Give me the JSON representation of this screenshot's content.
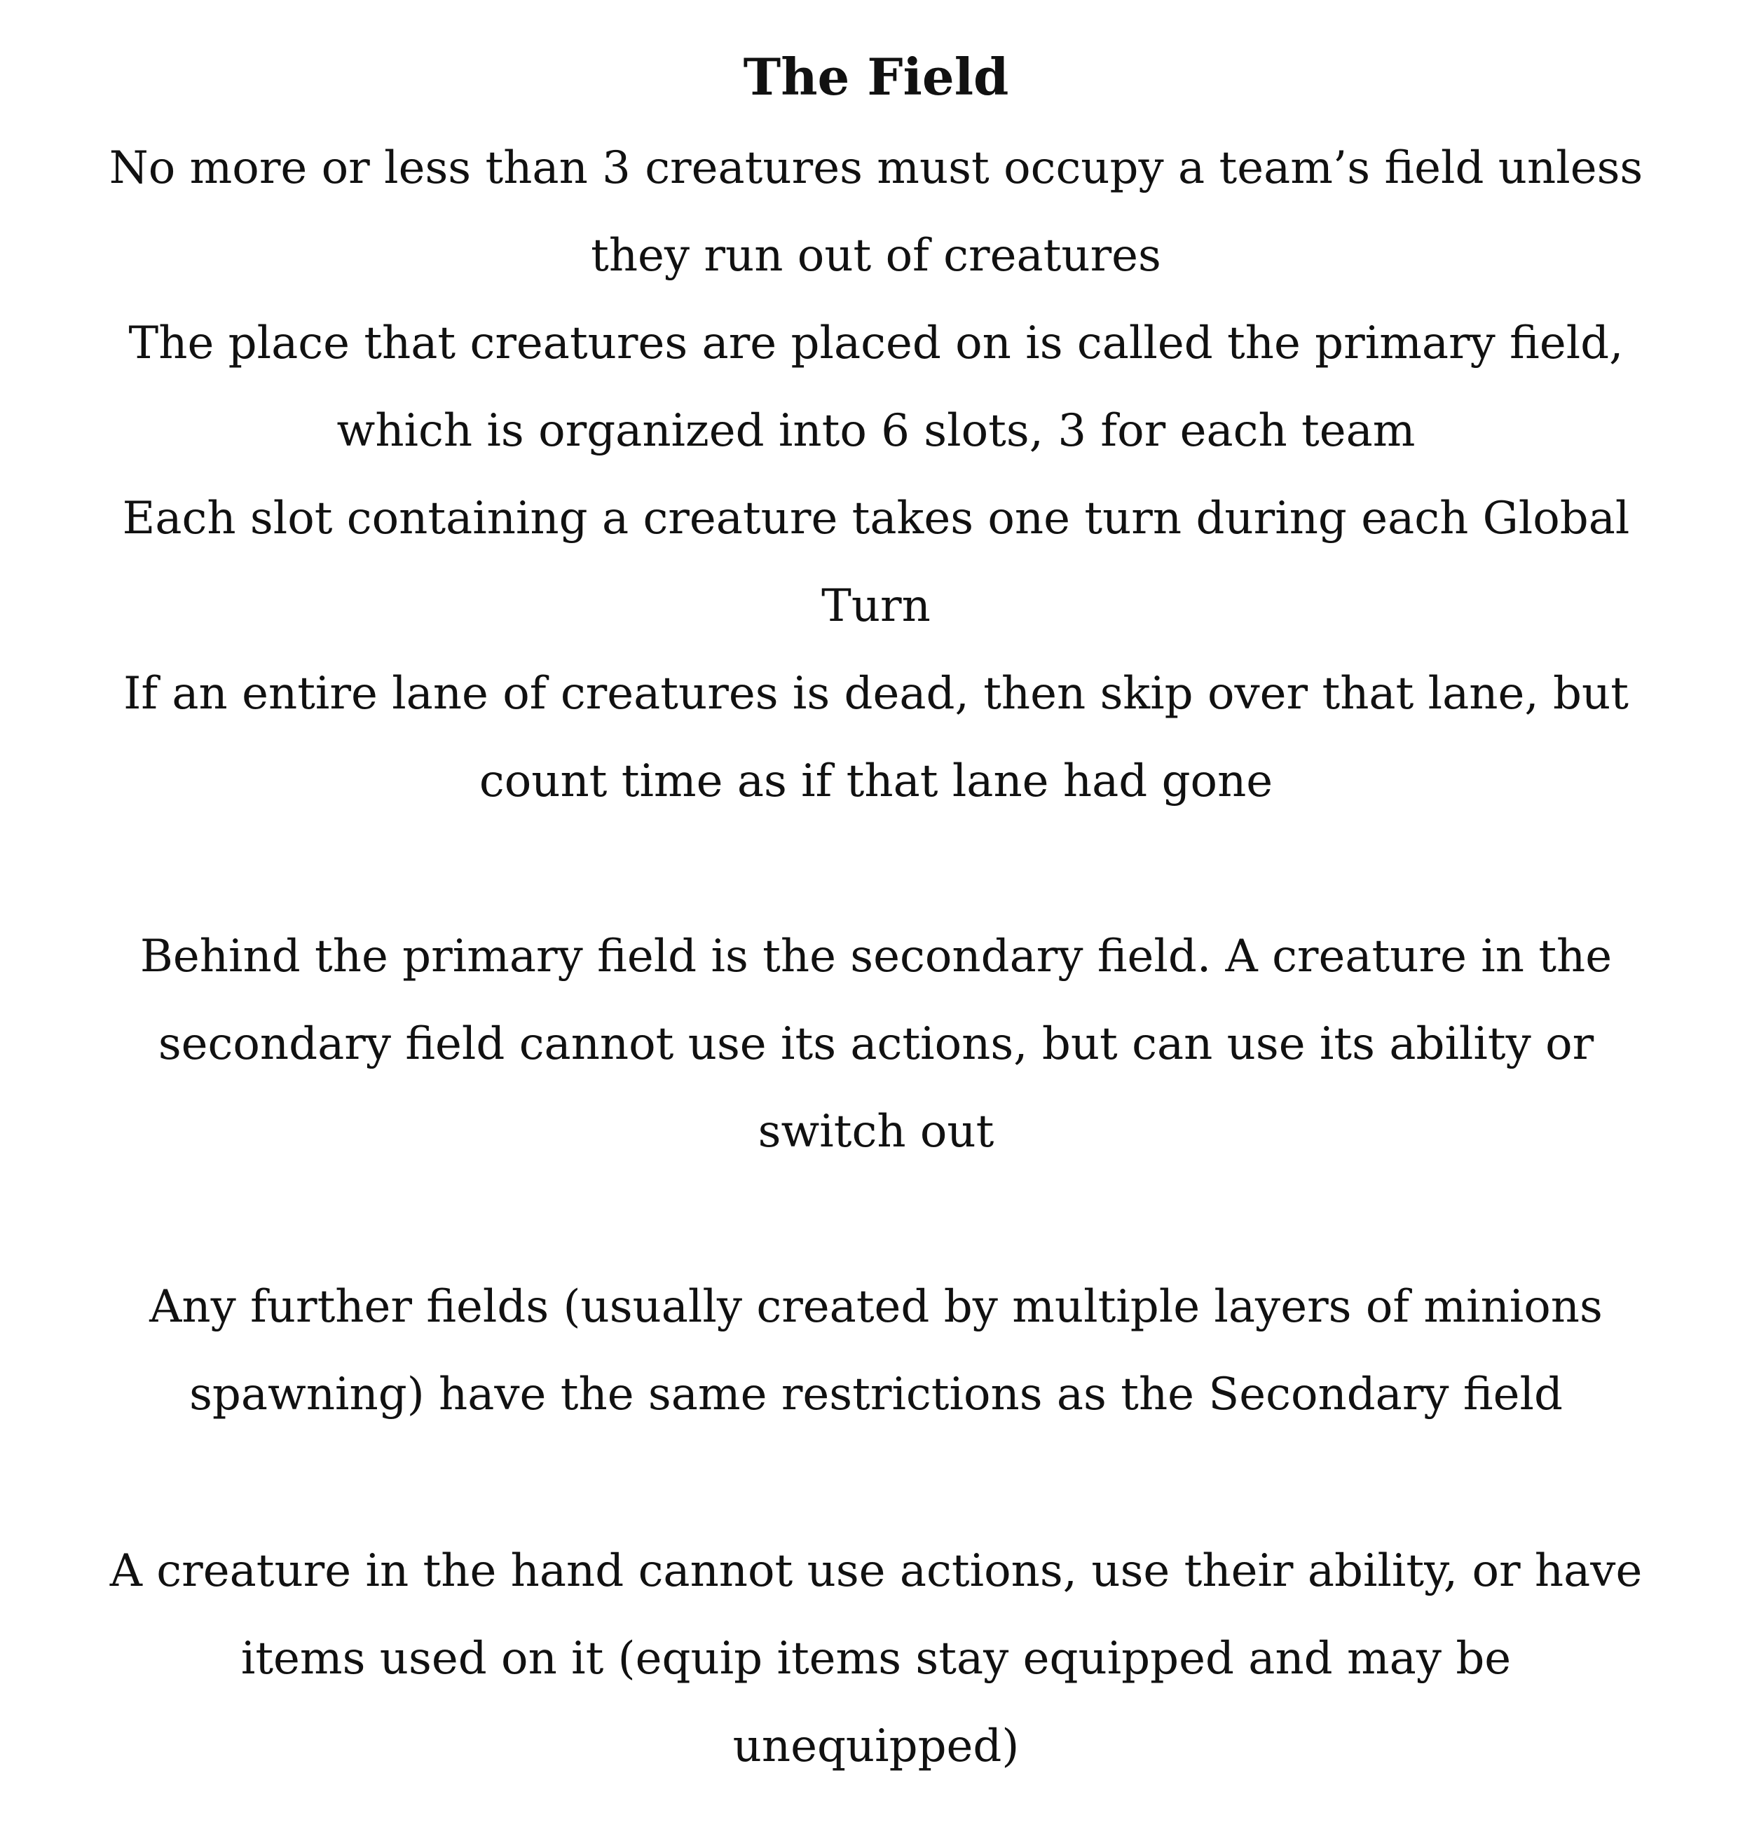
{
  "document": {
    "title": "The Field",
    "paragraphs": [
      {
        "lines": [
          "No more or less than 3 creatures must occupy a team’s field unless",
          "they run out of creatures"
        ]
      },
      {
        "lines": [
          "The place that creatures are placed on is called the primary field,",
          "which is organized into 6 slots, 3 for each team"
        ]
      },
      {
        "lines": [
          "Each slot containing a creature takes one turn during each Global",
          "Turn"
        ]
      },
      {
        "lines": [
          "If an entire lane of creatures is dead, then skip over that lane, but",
          "count time as if that lane had gone"
        ]
      },
      {
        "lines": [
          "Behind the primary field is the secondary field. A creature in the",
          "secondary field cannot use its actions, but can use its ability or",
          "switch out"
        ]
      },
      {
        "lines": [
          "Any further fields (usually created by multiple layers of minions",
          "spawning) have the same restrictions as the Secondary field"
        ]
      },
      {
        "lines": [
          "A creature in the hand cannot use actions, use their ability, or have",
          "items used on it (equip items stay equipped and may be",
          "unequipped)"
        ]
      }
    ]
  }
}
